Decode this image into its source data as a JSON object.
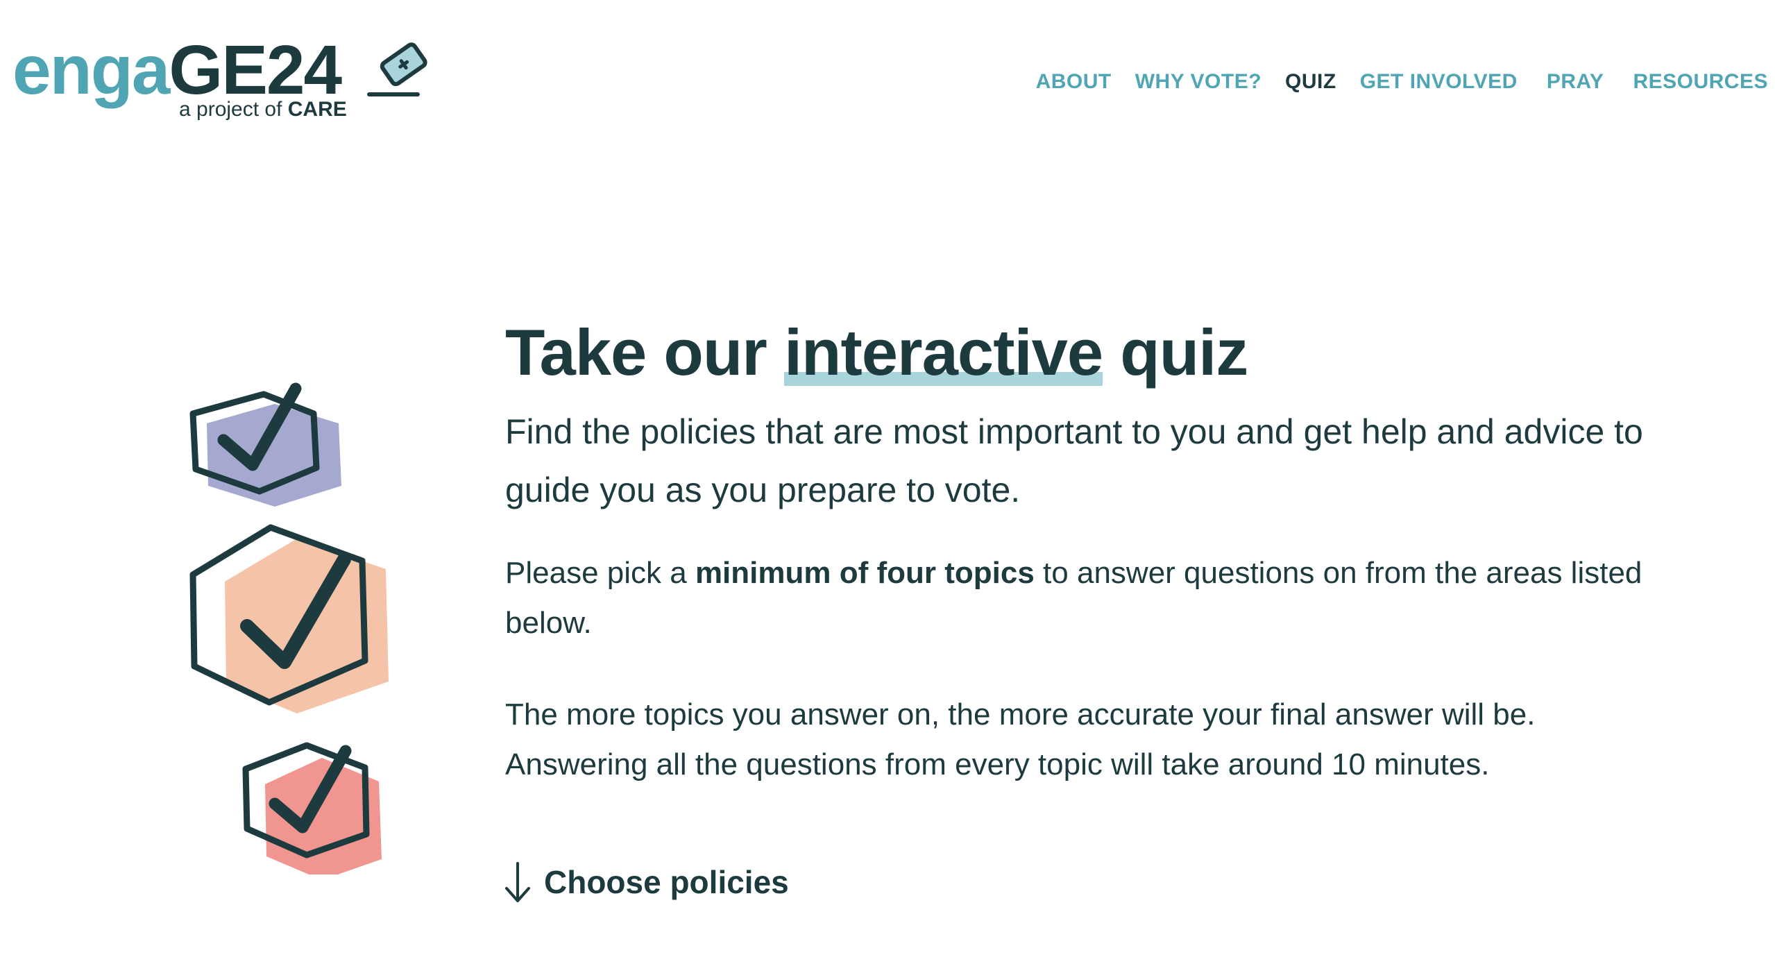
{
  "header": {
    "logo": {
      "word_light": "enga",
      "word_dark": "GE24",
      "sub_prefix": "a project of ",
      "sub_brand": "CARE",
      "icon": "ballot-box-icon"
    },
    "nav": [
      {
        "label": "ABOUT",
        "active": false
      },
      {
        "label": "WHY VOTE?",
        "active": false
      },
      {
        "label": "QUIZ",
        "active": true
      },
      {
        "label": "GET INVOLVED",
        "active": false
      },
      {
        "label": "PRAY",
        "active": false
      },
      {
        "label": "RESOURCES",
        "active": false
      }
    ]
  },
  "main": {
    "title_pre": "Take our ",
    "title_highlight": "interactive",
    "title_post": " quiz",
    "lead": "Find the policies that are most important to you and get help and advice to guide you as you prepare to vote.",
    "para1_pre": "Please pick a ",
    "para1_bold": "minimum of four topics",
    "para1_post": " to answer questions on from the areas listed below.",
    "para2": "The more topics you answer on, the more accurate your final answer will be. Answering all the questions from every topic will take around 10 minutes.",
    "cta_label": "Choose policies",
    "cta_icon": "arrow-down-icon"
  },
  "illustration": {
    "icons": [
      "checkbox-hexagon-icon",
      "checkbox-hexagon-icon",
      "checkbox-hexagon-icon"
    ],
    "colors": {
      "purple": "#a6a9cf",
      "peach": "#f5c3a8",
      "red": "#f0958f",
      "stroke": "#1d3a3f"
    }
  },
  "colors": {
    "brand_teal": "#4fa5b3",
    "brand_dark": "#1d3a3f",
    "highlight": "#a9d4db"
  }
}
